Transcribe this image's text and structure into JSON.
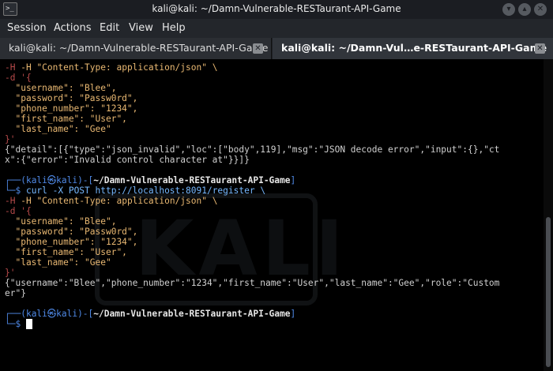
{
  "window": {
    "title": "kali@kali: ~/Damn-Vulnerable-RESTaurant-API-Game",
    "app_icon_text": ">_"
  },
  "window_buttons": {
    "minimize": "▾",
    "maximize": "▴",
    "close": "✕"
  },
  "menu": [
    "Session",
    "Actions",
    "Edit",
    "View",
    "Help"
  ],
  "tabs": [
    {
      "label": "kali@kali: ~/Damn-Vulnerable-RESTaurant-API-Game",
      "close": "✕"
    },
    {
      "label": "kali@kali: ~/Damn-Vul…e-RESTaurant-API-Game",
      "close": "✕"
    }
  ],
  "terminal": {
    "block1": {
      "header_line": "-H \"Content-Type: application/json\" \\",
      "d_line": "-d '{",
      "fields": [
        "  \"username\": \"Blee\",",
        "  \"password\": \"Passw0rd\",",
        "  \"phone_number\": \"1234\",",
        "  \"first_name\": \"User\",",
        "  \"last_name\": \"Gee\""
      ],
      "close_line": "}'",
      "output1": "{\"detail\":[{\"type\":\"json_invalid\",\"loc\":[\"body\",119],\"msg\":\"JSON decode error\",\"input\":{},\"ct",
      "output2": "x\":{\"error\":\"Invalid control character at\"}}]}"
    },
    "prompt1": {
      "top": "┌──(",
      "user": "kali",
      "skull": "㉿",
      "host": "kali",
      "mid": ")-[",
      "path": "~/Damn-Vulnerable-RESTaurant-API-Game",
      "end": "]",
      "arrow": "└─$",
      "command": " curl -X POST http://localhost:8091/register \\"
    },
    "block2": {
      "header_line": "-H \"Content-Type: application/json\" \\",
      "d_line": "-d '{",
      "fields": [
        "  \"username\": \"Blee\",",
        "  \"password\": \"Passw0rd\",",
        "  \"phone_number\": \"1234\",",
        "  \"first_name\": \"User\",",
        "  \"last_name\": \"Gee\""
      ],
      "close_line": "}'",
      "output1": "{\"username\":\"Blee\",\"phone_number\":\"1234\",\"first_name\":\"User\",\"last_name\":\"Gee\",\"role\":\"Custom",
      "output2": "er\"}"
    },
    "prompt2": {
      "top": "┌──(",
      "user": "kali",
      "skull": "㉿",
      "host": "kali",
      "mid": ")-[",
      "path": "~/Damn-Vulnerable-RESTaurant-API-Game",
      "end": "]",
      "arrow": "└─$"
    }
  }
}
